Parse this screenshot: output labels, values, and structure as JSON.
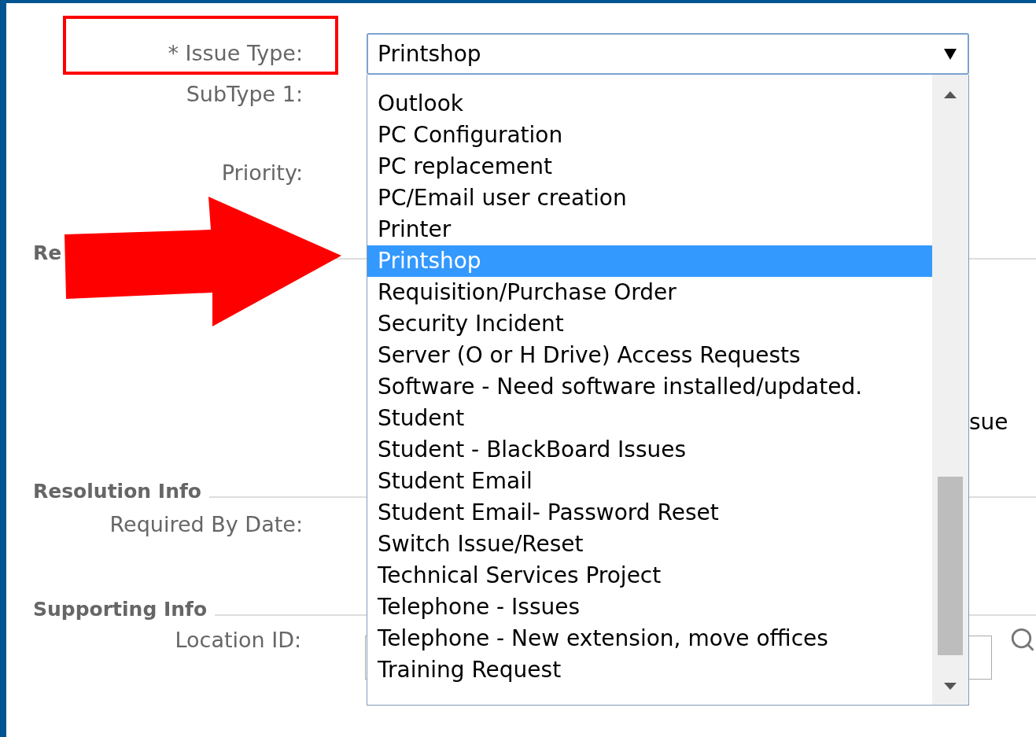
{
  "issue_type": {
    "label": "* Issue Type:",
    "highlighted": true,
    "value": "Printshop",
    "options": [
      {
        "label": "Outlook",
        "selected": false
      },
      {
        "label": "PC Configuration",
        "selected": false
      },
      {
        "label": "PC replacement",
        "selected": false
      },
      {
        "label": "PC/Email user creation",
        "selected": false
      },
      {
        "label": "Printer",
        "selected": false
      },
      {
        "label": "Printshop",
        "selected": true
      },
      {
        "label": "Requisition/Purchase Order",
        "selected": false
      },
      {
        "label": "Security Incident",
        "selected": false
      },
      {
        "label": "Server (O or H Drive) Access Requests",
        "selected": false
      },
      {
        "label": "Software - Need software installed/updated.",
        "selected": false
      },
      {
        "label": "Student",
        "selected": false
      },
      {
        "label": "Student - BlackBoard Issues",
        "selected": false
      },
      {
        "label": "Student Email",
        "selected": false
      },
      {
        "label": "Student Email- Password Reset",
        "selected": false
      },
      {
        "label": "Switch Issue/Reset",
        "selected": false
      },
      {
        "label": "Technical Services Project",
        "selected": false
      },
      {
        "label": "Telephone - Issues",
        "selected": false
      },
      {
        "label": "Telephone - New extension, move offices",
        "selected": false
      },
      {
        "label": "Training Request",
        "selected": false
      }
    ]
  },
  "subtype_label": "SubType 1:",
  "priority_label": "Priority:",
  "request_heading": "Re",
  "partial_text": "sue",
  "resolution": {
    "heading": "Resolution Info",
    "required_by_label": "Required By Date:"
  },
  "supporting": {
    "heading": "Supporting Info",
    "location_label": "Location ID:"
  }
}
